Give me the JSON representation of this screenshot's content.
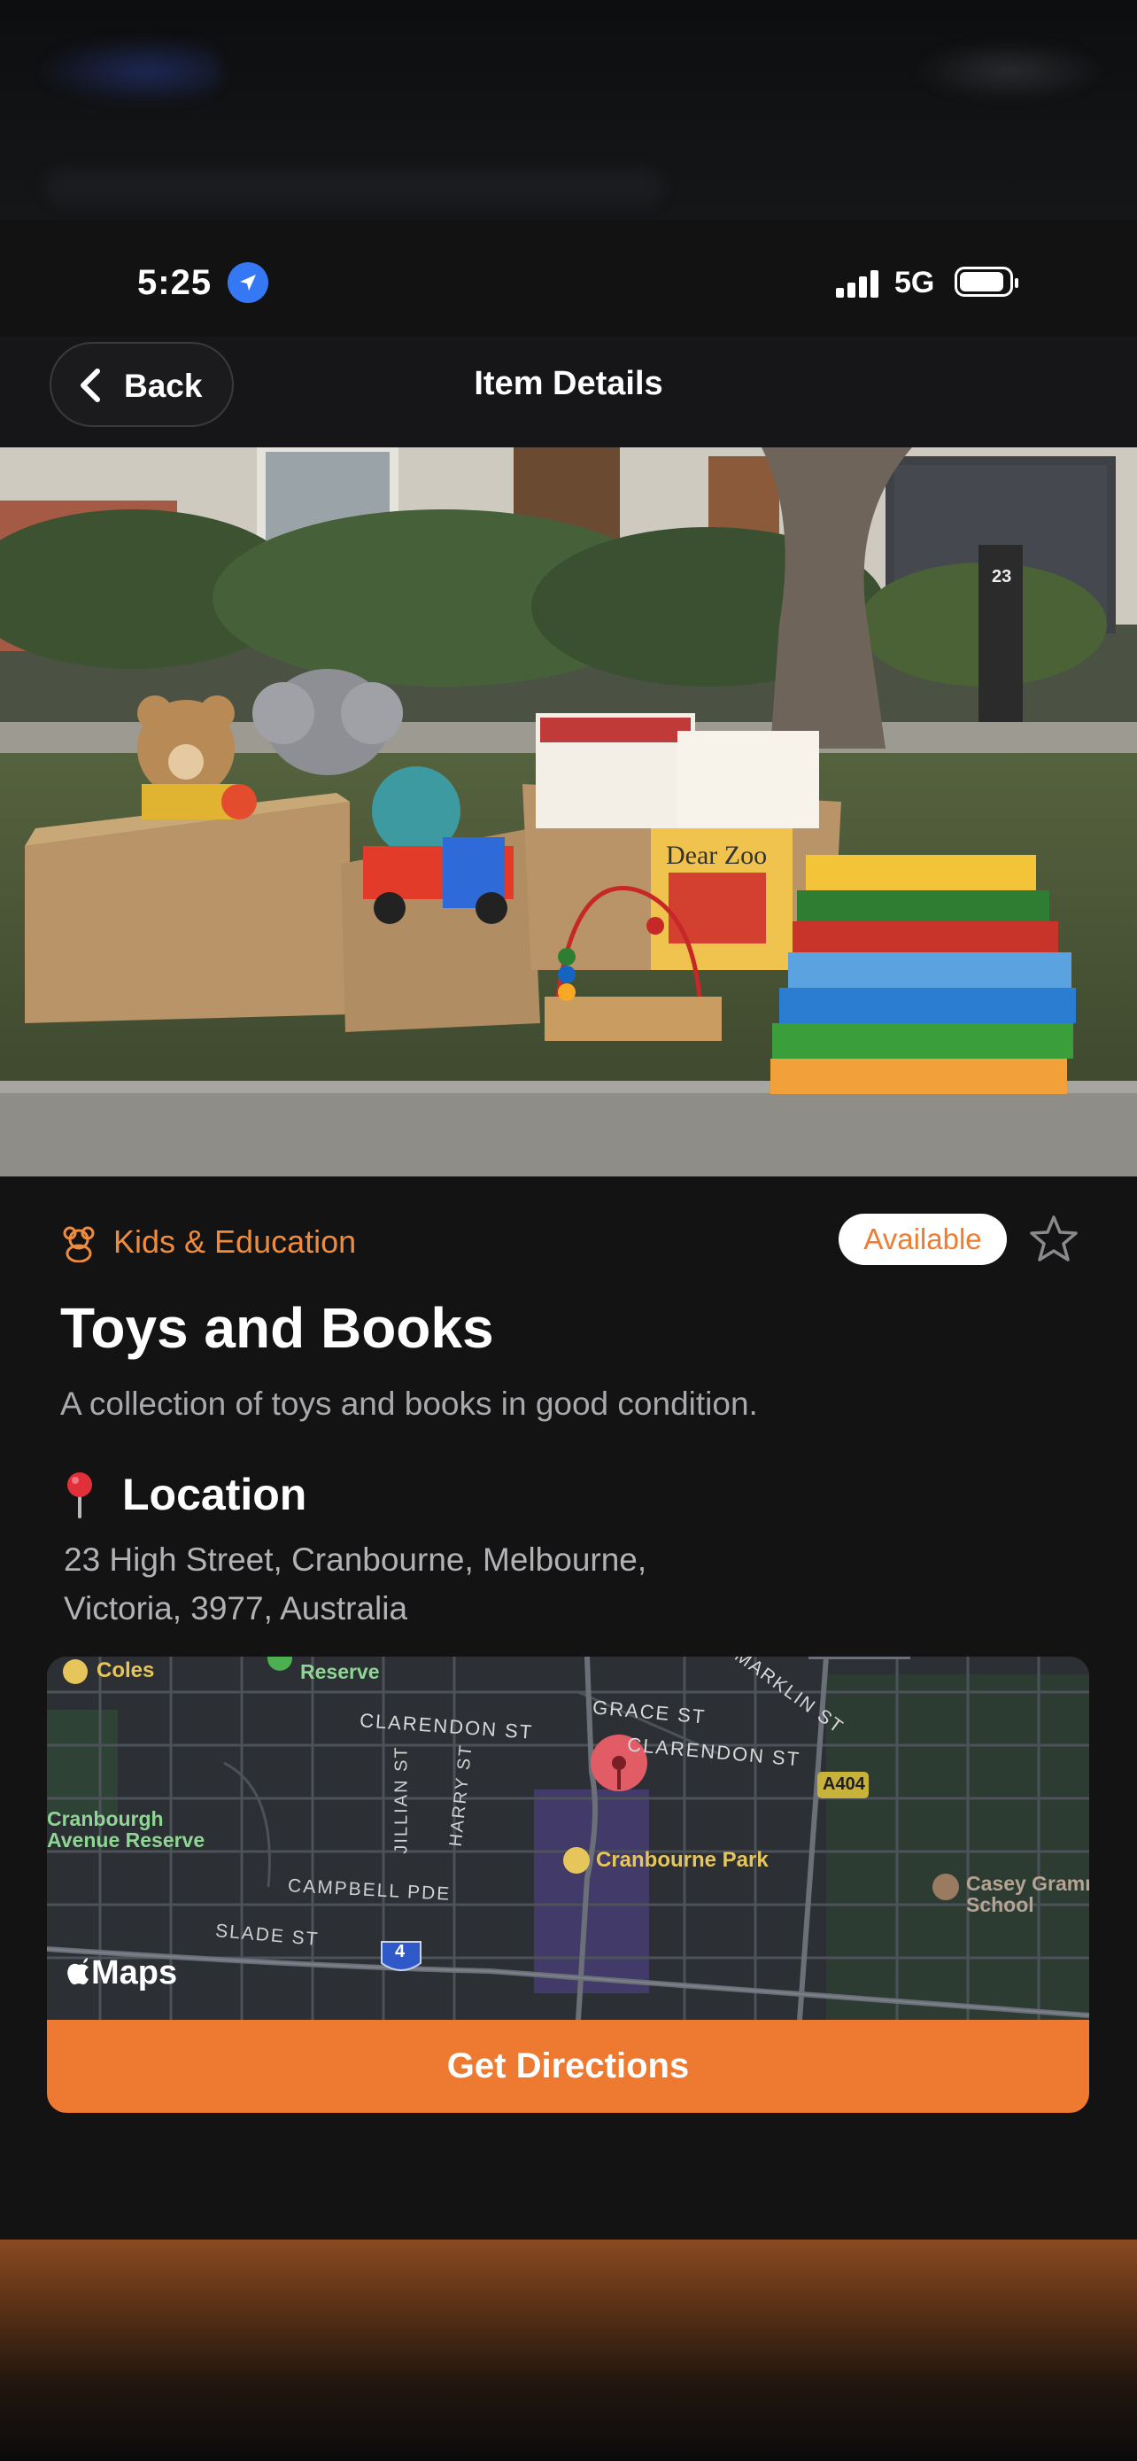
{
  "status_bar": {
    "time": "5:25",
    "network": "5G"
  },
  "nav": {
    "back_label": "Back",
    "title": "Item Details"
  },
  "photo": {
    "description_icon": "photo-toys-books",
    "house_number": "23"
  },
  "item": {
    "category_icon": "teddy-bear-icon",
    "category": "Kids & Education",
    "status": "Available",
    "title": "Toys and Books",
    "description": "A collection of toys and books in good condition."
  },
  "location": {
    "heading": "Location",
    "address_line1": "23 High Street, Cranbourne, Melbourne,",
    "address_line2": "Victoria, 3977, Australia"
  },
  "map": {
    "labels": {
      "coles": "Coles",
      "reserve": "Reserve",
      "clarendon_st_1": "CLARENDON ST",
      "clarendon_st_2": "CLARENDON ST",
      "grace_st": "GRACE ST",
      "marklin_st": "MARKLIN ST",
      "a404": "A404",
      "jillian_st": "JILLIAN ST",
      "harry_st": "HARRY ST",
      "cranbourne_avenue_reserve_1": "Cranbourgh",
      "cranbourne_avenue_reserve_2": "Avenue Reserve",
      "cranbourne_park": "Cranbourne Park",
      "campbell_pde": "CAMPBELL PDE",
      "slade_st": "SLADE ST",
      "route_4": "4",
      "casey_1": "Casey Grammar",
      "casey_2": "School"
    },
    "attribution": "Maps"
  },
  "actions": {
    "directions_label": "Get Directions"
  },
  "colors": {
    "accent": "#ee7a31",
    "background": "#131314",
    "location_blue": "#3478f6"
  }
}
